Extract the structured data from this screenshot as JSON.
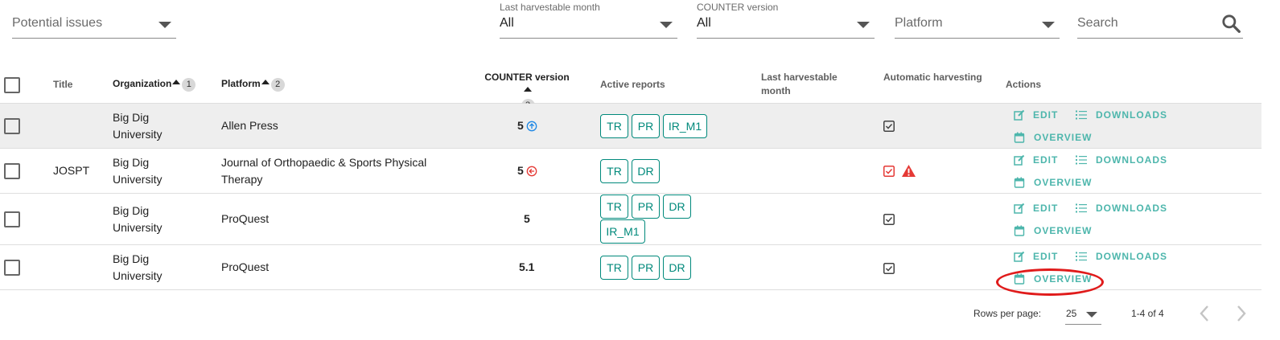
{
  "filters": {
    "potential_issues": {
      "placeholder": "Potential issues"
    },
    "last_harvestable_month": {
      "label": "Last harvestable month",
      "value": "All"
    },
    "counter_version": {
      "label": "COUNTER version",
      "value": "All"
    },
    "platform": {
      "placeholder": "Platform"
    },
    "search": {
      "placeholder": "Search"
    }
  },
  "table": {
    "headers": {
      "title": "Title",
      "organization": "Organization",
      "organization_sort": "1",
      "platform": "Platform",
      "platform_sort": "2",
      "counter_version": "COUNTER version",
      "counter_version_sort": "3",
      "active_reports": "Active reports",
      "last_harvestable_month_line1": "Last harvestable",
      "last_harvestable_month_line2": "month",
      "automatic_harvesting": "Automatic harvesting",
      "actions": "Actions"
    },
    "rows": [
      {
        "title": "",
        "org_line1": "Big Dig",
        "org_line2": "University",
        "platform_line1": "Allen Press",
        "platform_line2": "",
        "version": "5",
        "reports": [
          "TR",
          "PR",
          "IR_M1"
        ],
        "last_month": "",
        "auto_harvest": true,
        "warning": false
      },
      {
        "title": "JOSPT",
        "org_line1": "Big Dig",
        "org_line2": "University",
        "platform_line1": "Journal of Orthopaedic & Sports Physical",
        "platform_line2": "Therapy",
        "version": "5",
        "reports": [
          "TR",
          "DR"
        ],
        "last_month": "",
        "auto_harvest": true,
        "warning": true
      },
      {
        "title": "",
        "org_line1": "Big Dig",
        "org_line2": "University",
        "platform_line1": "ProQuest",
        "platform_line2": "",
        "version": "5",
        "reports": [
          "TR",
          "PR",
          "DR",
          "IR_M1"
        ],
        "last_month": "",
        "auto_harvest": true,
        "warning": false
      },
      {
        "title": "",
        "org_line1": "Big Dig",
        "org_line2": "University",
        "platform_line1": "ProQuest",
        "platform_line2": "",
        "version": "5.1",
        "reports": [
          "TR",
          "PR",
          "DR"
        ],
        "last_month": "",
        "auto_harvest": true,
        "warning": false
      }
    ],
    "actions": {
      "edit": "EDIT",
      "downloads": "DOWNLOADS",
      "overview": "OVERVIEW"
    }
  },
  "pagination": {
    "rows_per_page_label": "Rows per page:",
    "rows_per_page_value": "25",
    "range": "1-4 of 4"
  },
  "colors": {
    "accent": "#00897b",
    "action": "#4db6ac",
    "warning": "#e53935",
    "info": "#1e88e5",
    "annotation": "#e01b1b"
  }
}
